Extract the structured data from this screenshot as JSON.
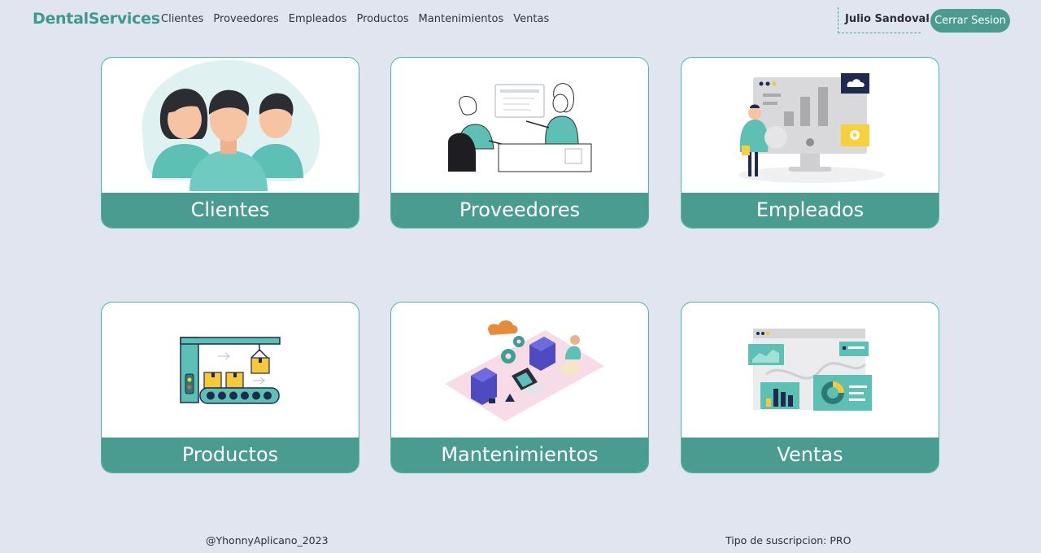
{
  "brand": {
    "name": "DentalServices"
  },
  "nav": {
    "links": [
      "Clientes",
      "Proveedores",
      "Empleados",
      "Productos",
      "Mantenimientos",
      "Ventas"
    ]
  },
  "user": {
    "name": "Julio Sandoval",
    "logout_label": "Cerrar Sesion"
  },
  "cards": [
    {
      "label": "Clientes",
      "icon": "customers-illustration"
    },
    {
      "label": "Proveedores",
      "icon": "suppliers-meeting-illustration"
    },
    {
      "label": "Empleados",
      "icon": "employee-dashboard-illustration"
    },
    {
      "label": "Productos",
      "icon": "conveyor-boxes-illustration"
    },
    {
      "label": "Mantenimientos",
      "icon": "servers-maintenance-illustration"
    },
    {
      "label": "Ventas",
      "icon": "sales-analytics-illustration"
    }
  ],
  "footer": {
    "credit": "@YhonnyAplicano_2023",
    "subscription": "Tipo de suscripcion: PRO"
  },
  "colors": {
    "accent": "#4a9b90",
    "background": "#e1e5ef",
    "card_border": "#4fb3a6"
  }
}
